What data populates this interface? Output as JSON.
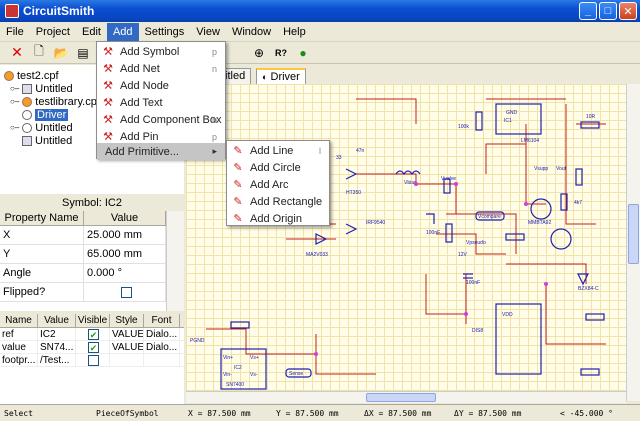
{
  "window": {
    "title": "CircuitSmith"
  },
  "menubar": [
    "File",
    "Project",
    "Edit",
    "Add",
    "Settings",
    "View",
    "Window",
    "Help"
  ],
  "tree": {
    "items": [
      {
        "label": "test2.cpf",
        "icon": "project-icon"
      },
      {
        "label": "Untitled",
        "icon": "schematic-icon"
      },
      {
        "label": "testlibrary.cpf",
        "icon": "library-icon"
      },
      {
        "label": "Driver",
        "icon": "driver-icon"
      },
      {
        "label": "Untitled",
        "icon": "folder-icon"
      },
      {
        "label": "Untitled",
        "icon": "schematic-icon"
      }
    ]
  },
  "properties": {
    "header": "Symbol: IC2",
    "col_name": "Property Name",
    "col_value": "Value",
    "rows": [
      {
        "name": "X",
        "value": "25.000 mm"
      },
      {
        "name": "Y",
        "value": "65.000 mm"
      },
      {
        "name": "Angle",
        "value": "0.000 °"
      },
      {
        "name": "Flipped?",
        "value": ""
      }
    ]
  },
  "texts_table": {
    "headers": [
      "Name",
      "Value",
      "Visible",
      "Style",
      "Font"
    ],
    "rows": [
      {
        "name": "ref",
        "value": "IC2",
        "visible": true,
        "style": "VALUE",
        "font": "Dialo..."
      },
      {
        "name": "value",
        "value": "SN74...",
        "visible": true,
        "style": "VALUE",
        "font": "Dialo..."
      },
      {
        "name": "footpr...",
        "value": "/Test...",
        "visible": false,
        "style": "",
        "font": ""
      }
    ]
  },
  "doc_tabs": [
    {
      "label": "titled"
    },
    {
      "label": "Driver"
    }
  ],
  "add_menu": {
    "items": [
      {
        "label": "Add Symbol",
        "key": "p"
      },
      {
        "label": "Add Net",
        "key": "n"
      },
      {
        "label": "Add Node",
        "key": ""
      },
      {
        "label": "Add Text",
        "key": ""
      },
      {
        "label": "Add Component Box",
        "key": "b"
      },
      {
        "label": "Add Pin",
        "key": "p"
      },
      {
        "label": "Add Primitive...",
        "key": "▸"
      }
    ]
  },
  "primitive_menu": {
    "items": [
      {
        "label": "Add Line",
        "key": "l"
      },
      {
        "label": "Add Circle",
        "key": ""
      },
      {
        "label": "Add Arc",
        "key": ""
      },
      {
        "label": "Add Rectangle",
        "key": ""
      },
      {
        "label": "Add Origin",
        "key": ""
      }
    ]
  },
  "status": {
    "mode": "Select",
    "object": "PieceOfSymbol",
    "x": "X = 87.500 mm",
    "y": "Y = 87.500 mm",
    "dx": "ΔX = 87.500 mm",
    "dy": "ΔY = 87.500 mm",
    "angle": "< -45.000 °"
  },
  "schematic_labels": [
    "IC1",
    "IC2",
    "GND",
    "LM6104",
    "MMBTA92",
    "100k",
    "10R",
    "4k7",
    "VDD",
    "DIS8",
    "Vsupp",
    "Vout",
    "Vbias",
    "Vvalve",
    "Vcompare",
    "Vpseudo",
    "BZX84-C",
    "HT350",
    "12V",
    "100nF",
    "100nF",
    "IRF9540",
    "MA2V033",
    "47n",
    "33",
    "SN7400",
    "Vin+",
    "Vin-",
    "Vs+",
    "Vs-",
    "Sense",
    "PGND"
  ],
  "colors": {
    "accent": "#316ac5",
    "wire": "#c02020",
    "component": "#2020b0",
    "grid": "#f1e2a8"
  }
}
